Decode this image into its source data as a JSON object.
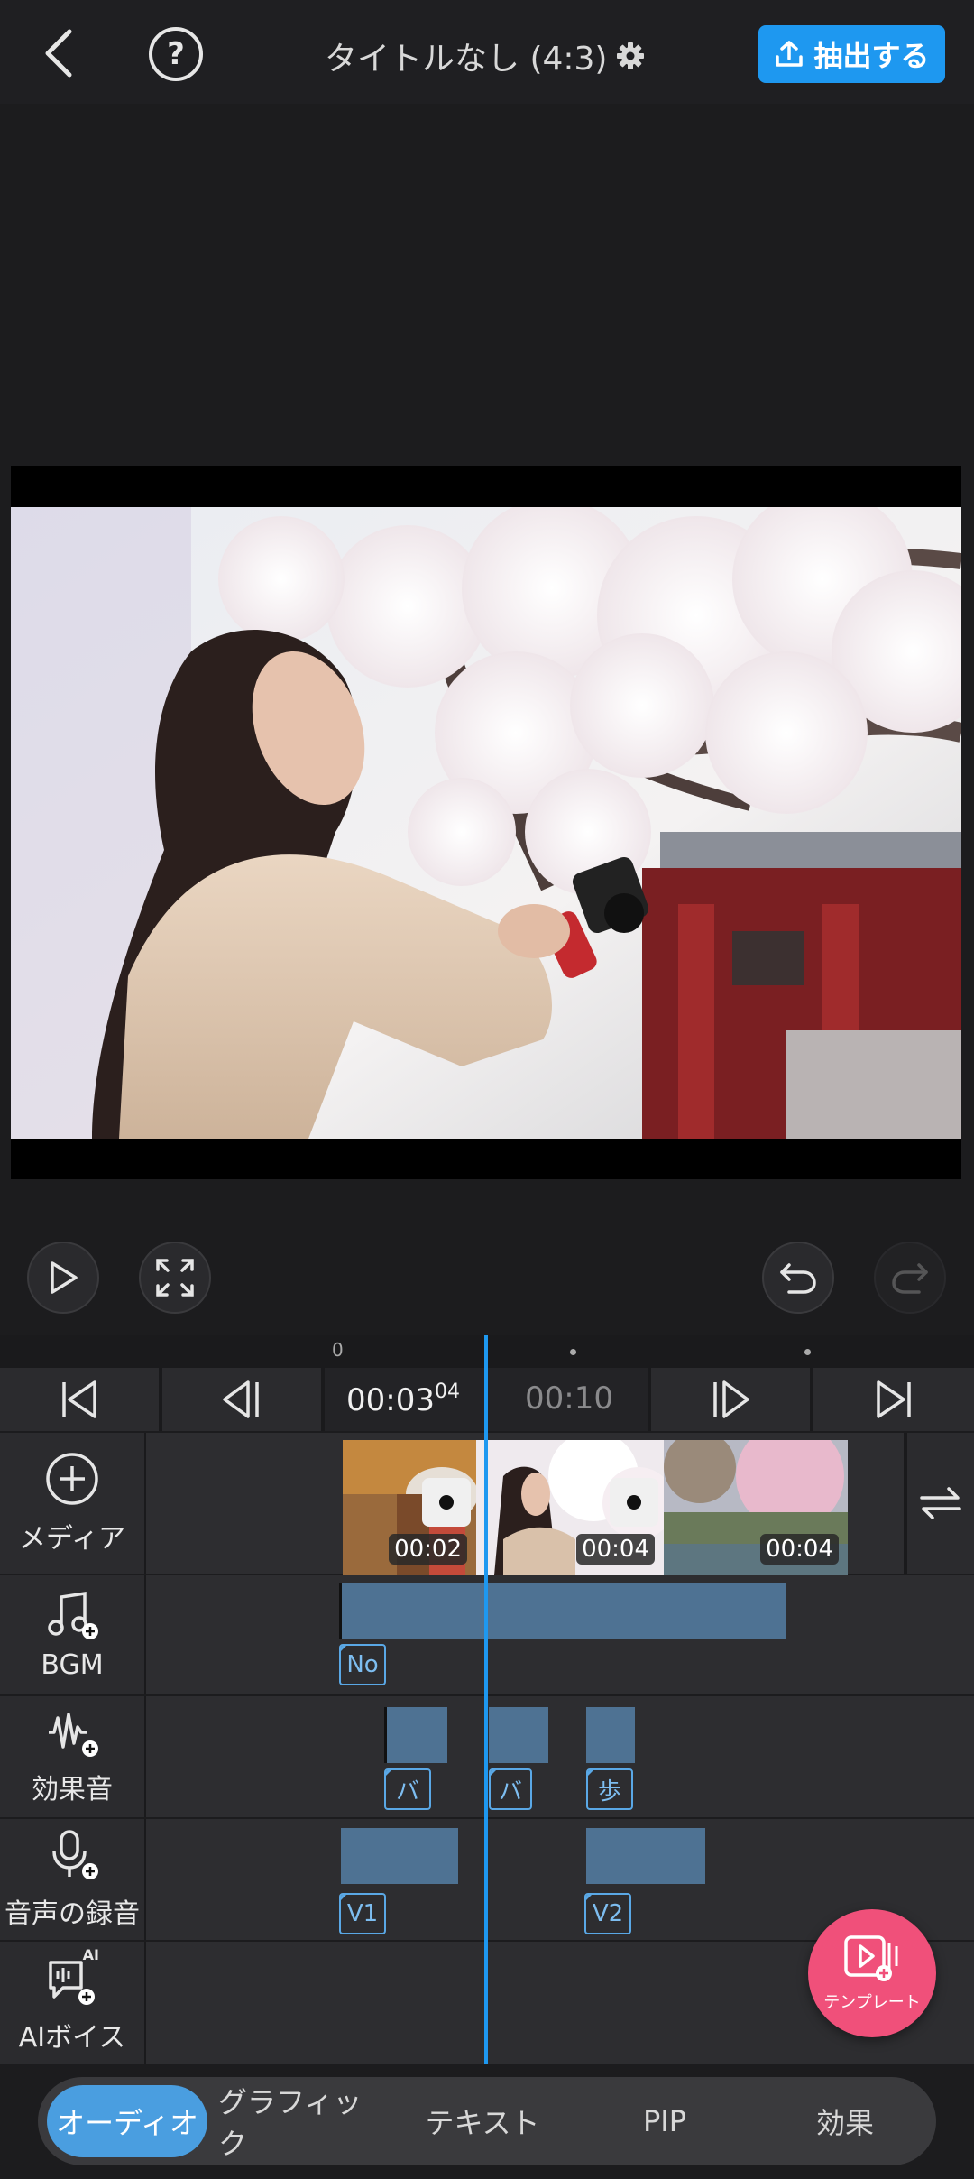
{
  "header": {
    "title": "タイトルなし (4:3)",
    "export_label": "抽出する",
    "help_label": "?"
  },
  "timeline": {
    "ruler_zero": "0",
    "current_time": "00:03",
    "current_frames": "04",
    "total_time": "00:10"
  },
  "tracks": {
    "media": {
      "label": "メディア",
      "clips": [
        {
          "duration": "00:02"
        },
        {
          "duration": "00:04"
        },
        {
          "duration": "00:04"
        }
      ]
    },
    "bgm": {
      "label": "BGM",
      "tags": [
        "No"
      ]
    },
    "sfx": {
      "label": "効果音",
      "tags": [
        "バ",
        "バ",
        "歩"
      ]
    },
    "voice": {
      "label": "音声の録音",
      "tags": [
        "V1",
        "V2"
      ]
    },
    "ai_voice": {
      "label": "AIボイス",
      "badge": "AI"
    }
  },
  "template_button": {
    "label": "テンプレート"
  },
  "tabs": [
    {
      "label": "オーディオ",
      "active": true
    },
    {
      "label": "グラフィック",
      "active": false
    },
    {
      "label": "テキスト",
      "active": false
    },
    {
      "label": "PIP",
      "active": false
    },
    {
      "label": "効果",
      "active": false
    }
  ],
  "colors": {
    "accent": "#1e98f0",
    "audio_clip": "#4e7293",
    "template": "#f0507a"
  }
}
